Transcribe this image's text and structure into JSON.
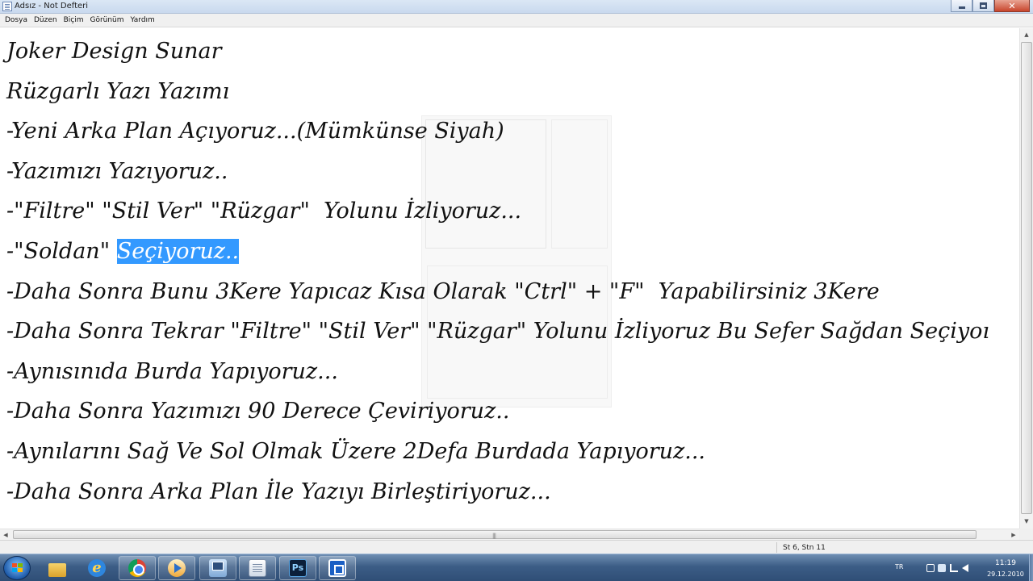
{
  "window": {
    "title": "Adsız - Not Defteri",
    "controls": {
      "minimize_icon": "minimize-icon",
      "maximize_icon": "restore-icon",
      "close_label": "✕"
    }
  },
  "menu": [
    {
      "label": "Dosya"
    },
    {
      "label": "Düzen"
    },
    {
      "label": "Biçim"
    },
    {
      "label": "Görünüm"
    },
    {
      "label": "Yardım"
    }
  ],
  "editor": {
    "lines": [
      {
        "text": "Joker Design Sunar"
      },
      {
        "text": "Rüzgarlı Yazı Yazımı"
      },
      {
        "text": "-Yeni Arka Plan Açıyoruz...(Mümkünse Siyah)"
      },
      {
        "text": "-Yazımızı Yazıyoruz.."
      },
      {
        "text": "-\"Filtre\" \"Stil Ver\" \"Rüzgar\"  Yolunu İzliyoruz..."
      },
      {
        "text": "-\"Soldan\" ",
        "selected": "Seçiyoruz.."
      },
      {
        "text": "-Daha Sonra Bunu 3Kere Yapıcaz Kısa Olarak \"Ctrl\" + \"F\"  Yapabilirsiniz 3Kere"
      },
      {
        "text": "-Daha Sonra Tekrar \"Filtre\" \"Stil Ver\" \"Rüzgar\" Yolunu İzliyoruz Bu Sefer Sağdan Seçiyoı"
      },
      {
        "text": "-Aynısınıda Burda Yapıyoruz..."
      },
      {
        "text": "-Daha Sonra Yazımızı 90 Derece Çeviriyoruz.."
      },
      {
        "text": "-Aynılarını Sağ Ve Sol Olmak Üzere 2Defa Burdada Yapıyoruz..."
      },
      {
        "text": "-Daha Sonra Arka Plan İle Yazıyı Birleştiriyoruz..."
      }
    ],
    "selection_color": "#3399ff"
  },
  "statusbar": {
    "position": "St 6, Stn 11"
  },
  "taskbar": {
    "items": [
      {
        "icon": "folder-icon",
        "pinned": false
      },
      {
        "icon": "internet-explorer-icon",
        "pinned": false
      },
      {
        "icon": "chrome-icon",
        "pinned": true
      },
      {
        "icon": "media-player-icon",
        "pinned": true
      },
      {
        "icon": "network-app-icon",
        "pinned": true
      },
      {
        "icon": "notepad-icon",
        "pinned": true
      },
      {
        "icon": "photoshop-icon",
        "label": "Ps",
        "pinned": true
      },
      {
        "icon": "blue-app-icon",
        "pinned": true
      }
    ],
    "tray": {
      "language": "TR",
      "time": "11:19",
      "date": "29.12.2010"
    }
  },
  "colors": {
    "taskbar": "#3c5d86",
    "selection": "#3399ff",
    "text": "#111111"
  }
}
